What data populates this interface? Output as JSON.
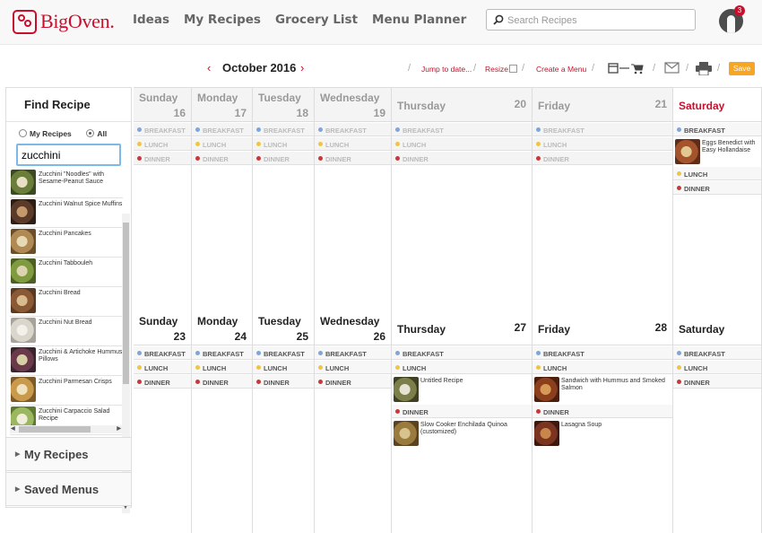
{
  "brand": {
    "name": "BigOven."
  },
  "nav": [
    "Ideas",
    "My Recipes",
    "Grocery List",
    "Menu Planner"
  ],
  "search": {
    "placeholder": "Search Recipes"
  },
  "notifications": {
    "count": "3"
  },
  "toolbar": {
    "month": "October 2016",
    "prev": "‹",
    "next": "›",
    "jump": "Jump to date...",
    "resize": "Resize:",
    "create_menu": "Create a Menu",
    "save": "Save"
  },
  "sidebar": {
    "title": "Find Recipe",
    "scope_my": "My Recipes",
    "scope_all": "All",
    "query": "zucchini",
    "results": [
      "Zucchini \"Noodles\" with Sesame-Peanut Sauce",
      "Zucchini Walnut Spice Muffins",
      "Zucchini Pancakes",
      "Zucchini Tabbouleh",
      "Zucchini Bread",
      "Zucchini Nut Bread",
      "Zucchini & Artichoke Hummus Pillows",
      "Zucchini Parmesan Crisps",
      "Zucchini Carpaccio Salad Recipe"
    ],
    "accordion": [
      "My Recipes",
      "Saved Menus"
    ]
  },
  "meal_labels": {
    "breakfast": "BREAKFAST",
    "lunch": "LUNCH",
    "dinner": "DINNER"
  },
  "weeks": [
    {
      "days": [
        {
          "name": "Sunday",
          "num": "16",
          "past": true
        },
        {
          "name": "Monday",
          "num": "17",
          "past": true
        },
        {
          "name": "Tuesday",
          "num": "18",
          "past": true
        },
        {
          "name": "Wednesday",
          "num": "19",
          "past": true
        },
        {
          "name": "Thursday",
          "num": "20",
          "past": true
        },
        {
          "name": "Friday",
          "num": "21",
          "past": true
        },
        {
          "name": "Saturday",
          "num": "",
          "past": false,
          "highlight": true,
          "breakfast": [
            "Eggs Benedict with Easy Hollandaise"
          ]
        }
      ]
    },
    {
      "days": [
        {
          "name": "Sunday",
          "num": "23"
        },
        {
          "name": "Monday",
          "num": "24"
        },
        {
          "name": "Tuesday",
          "num": "25"
        },
        {
          "name": "Wednesday",
          "num": "26"
        },
        {
          "name": "Thursday",
          "num": "27",
          "lunch": [
            "Untitled Recipe"
          ],
          "dinner": [
            "Slow Cooker Enchilada Quinoa (customized)"
          ]
        },
        {
          "name": "Friday",
          "num": "28",
          "lunch": [
            "Sandwich with Hummus and Smoked Salmon"
          ],
          "dinner": [
            "Lasagna Soup"
          ]
        },
        {
          "name": "Saturday",
          "num": ""
        }
      ]
    }
  ],
  "colors": {
    "brand": "#c8102e",
    "save": "#f6a623",
    "breakfast": "#7fa6d8",
    "lunch": "#f0c640",
    "dinner": "#c9373a"
  },
  "icons": [
    "search-icon",
    "calendar-to-cart-icon",
    "email-icon",
    "print-icon",
    "radio-icon"
  ]
}
